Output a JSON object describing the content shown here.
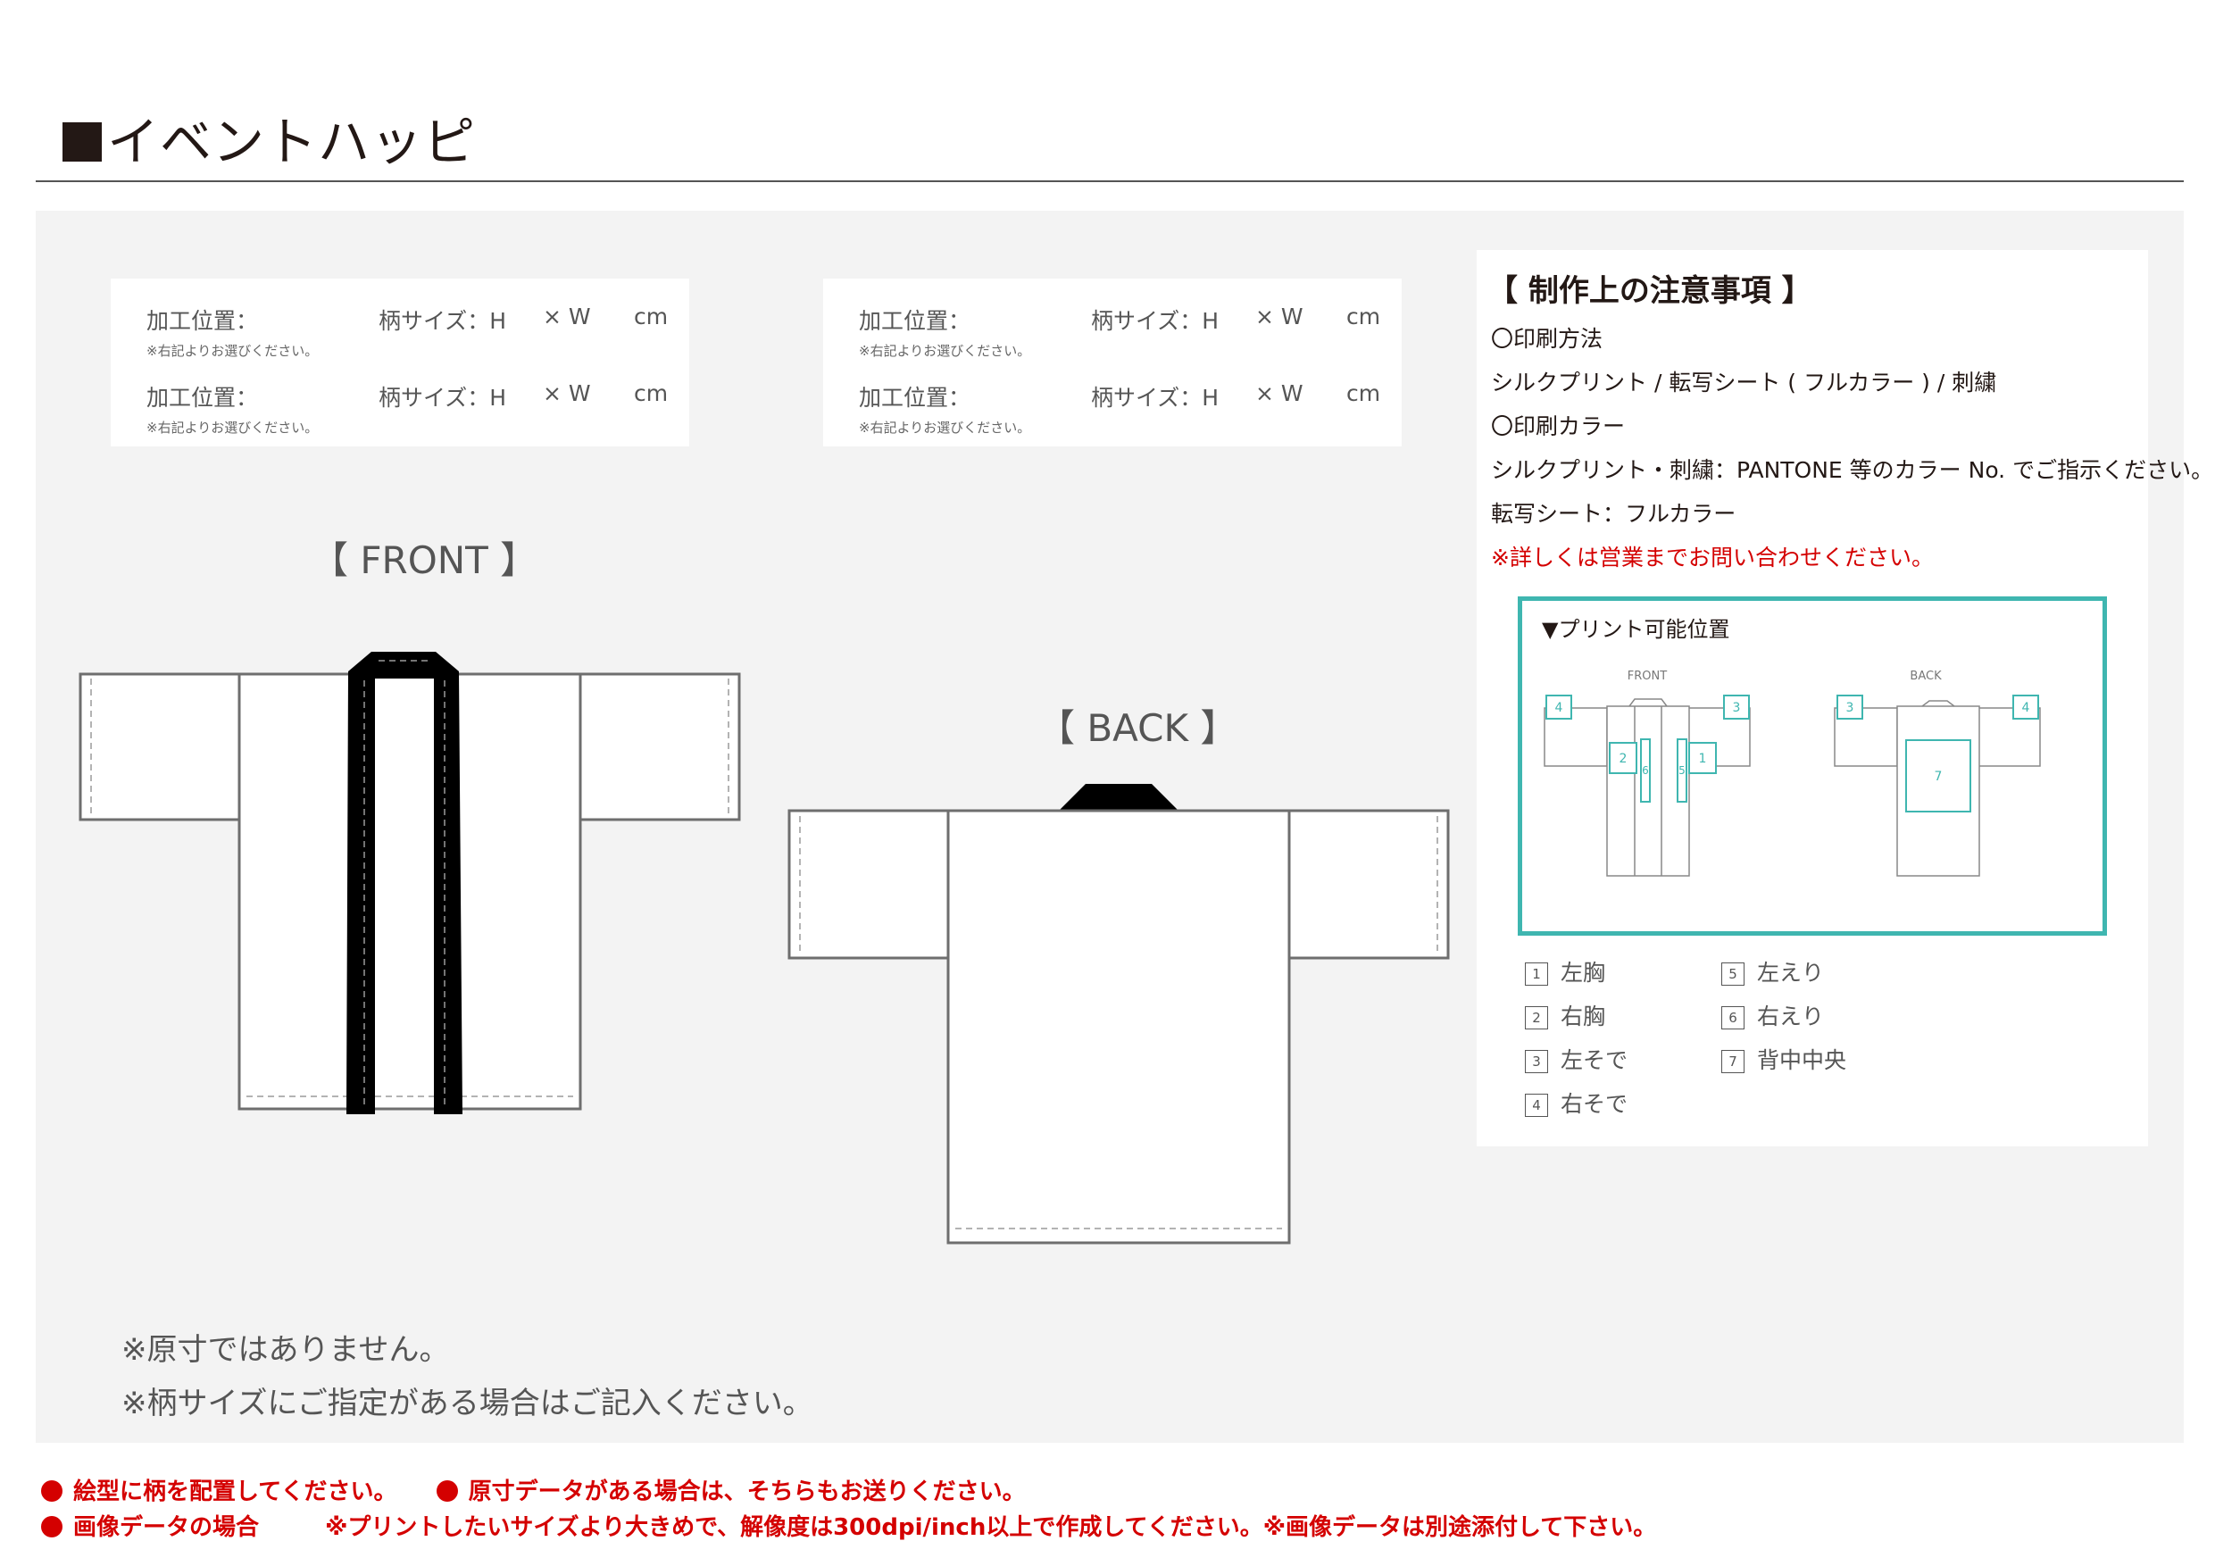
{
  "title": "イベントハッピ",
  "forms": {
    "row": {
      "position_label": "加工位置：",
      "position_note": "※右記よりお選びください。",
      "size_label": "柄サイズ：H",
      "times_w": "× W",
      "unit": "cm"
    }
  },
  "views": {
    "front": "【 FRONT 】",
    "back": "【 BACK 】"
  },
  "notes": {
    "heading": "【 制作上の注意事項 】",
    "method_heading": "〇印刷方法",
    "method_text": "シルクプリント / 転写シート ( フルカラー ) / 刺繍",
    "color_heading": "〇印刷カラー",
    "color_text_1": "シルクプリント・刺繍：PANTONE 等のカラー No. でご指示ください。",
    "color_text_2": "転写シート：フルカラー",
    "contact": "※詳しくは営業までお問い合わせください。"
  },
  "print_area": {
    "title": "▼プリント可能位置",
    "front_label": "FRONT",
    "back_label": "BACK",
    "legend": [
      {
        "num": "1",
        "label": "左胸"
      },
      {
        "num": "2",
        "label": "右胸"
      },
      {
        "num": "3",
        "label": "左そで"
      },
      {
        "num": "4",
        "label": "右そで"
      },
      {
        "num": "5",
        "label": "左えり"
      },
      {
        "num": "6",
        "label": "右えり"
      },
      {
        "num": "7",
        "label": "背中中央"
      }
    ]
  },
  "footnotes": {
    "line1": "※原寸ではありません。",
    "line2": "※柄サイズにご指定がある場合はご記入ください。"
  },
  "bottom": {
    "note1": "絵型に柄を配置してください。",
    "note2": "原寸データがある場合は、そちらもお送りください。",
    "note3_label": "画像データの場合",
    "note3_text": "※プリントしたいサイズより大きめで、解像度は300dpi/inch以上で作成してください。※画像データは別途添付して下さい。"
  },
  "colors": {
    "accent_teal": "#3fb6b0",
    "warning_red": "#d40000",
    "text_dark": "#231815"
  }
}
